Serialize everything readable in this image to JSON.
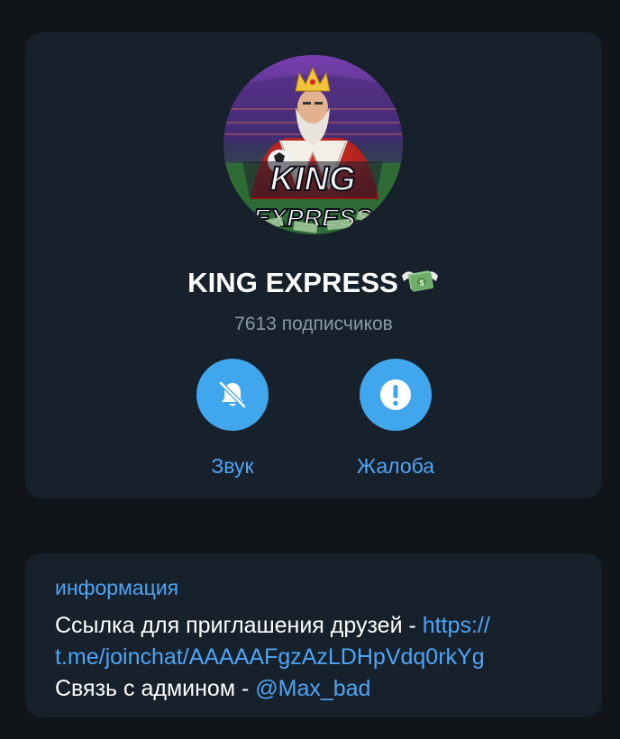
{
  "profile": {
    "title": "KING EXPRESS",
    "title_emoji": "money-with-wings-icon",
    "subscribers": "7613 подписчиков",
    "avatar": {
      "logo_line1": "KING",
      "logo_line2": "EXPRESS"
    }
  },
  "actions": [
    {
      "label": "Звук",
      "icon": "bell-muted-icon"
    },
    {
      "label": "Жалоба",
      "icon": "exclamation-icon"
    }
  ],
  "info": {
    "heading": "информация",
    "invite_prefix": "Ссылка для приглашения друзей - ",
    "invite_link_line1": "https://",
    "invite_link_line2": "t.me/joinchat/AAAAAFgzAzLDHpVdq0rkYg",
    "admin_prefix": "Связь с админом - ",
    "admin_handle": "@Max_bad"
  },
  "colors": {
    "background": "#111418",
    "card": "#17212b",
    "accent": "#40a7ee",
    "link": "#4ea4f6",
    "muted_text": "#8b98a5"
  }
}
